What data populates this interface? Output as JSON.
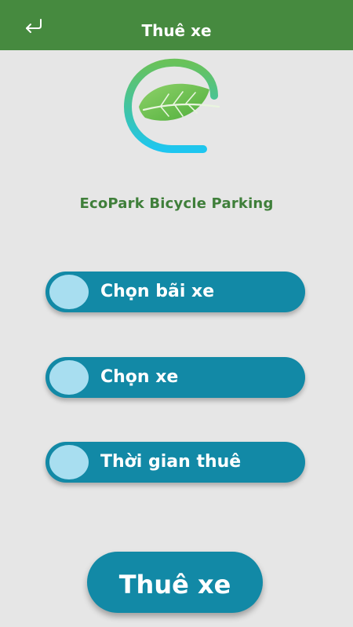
{
  "appbar": {
    "title": "Thuê xe",
    "back_icon": "return-arrow-icon",
    "color": "#468a3f"
  },
  "logo": {
    "icon": "eco-leaf-e-logo",
    "colors": {
      "leaf": "#6cc04a",
      "ring_top": "#69c25a",
      "ring_bottom": "#1ec6f0"
    }
  },
  "brand": {
    "name": "EcoPark Bicycle Parking",
    "color": "#3f7f3a"
  },
  "options": [
    {
      "label": "Chọn bãi xe"
    },
    {
      "label": "Chọn xe"
    },
    {
      "label": "Thời gian thuê"
    }
  ],
  "colors": {
    "accent": "#1289a6",
    "knob": "#a8def0",
    "background": "#e6e6e6"
  },
  "rent_button": {
    "label": "Thuê xe"
  }
}
